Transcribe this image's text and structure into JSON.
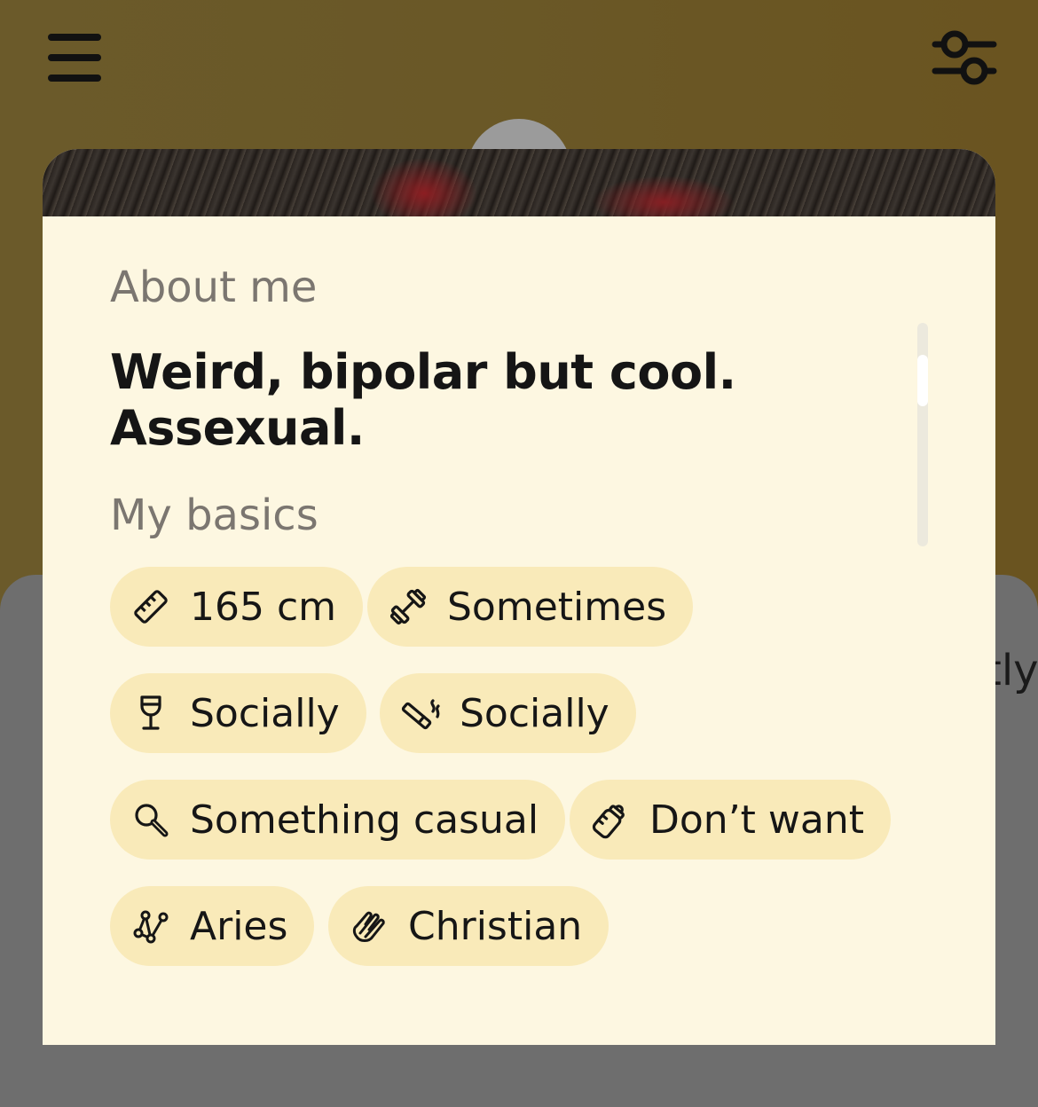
{
  "header": {
    "menu_icon": "hamburger-menu-icon",
    "filter_icon": "sliders-filter-icon"
  },
  "background_card": {
    "partial_text": "tly"
  },
  "profile": {
    "about": {
      "title": "About me",
      "text": "Weird, bipolar but cool. Assexual."
    },
    "basics": {
      "title": "My basics",
      "chips": [
        {
          "icon": "ruler-icon",
          "label": "165 cm"
        },
        {
          "icon": "dumbbell-icon",
          "label": "Sometimes"
        },
        {
          "icon": "wine-glass-icon",
          "label": "Socially"
        },
        {
          "icon": "cigarette-icon",
          "label": "Socially"
        },
        {
          "icon": "magnifier-icon",
          "label": "Something casual"
        },
        {
          "icon": "baby-bottle-icon",
          "label": "Don’t want"
        },
        {
          "icon": "constellation-icon",
          "label": "Aries"
        },
        {
          "icon": "praying-hands-icon",
          "label": "Christian"
        }
      ]
    }
  },
  "colors": {
    "card_background": "#fdf7e1",
    "chip_background": "#f9eab9",
    "backdrop": "#6a5827"
  }
}
